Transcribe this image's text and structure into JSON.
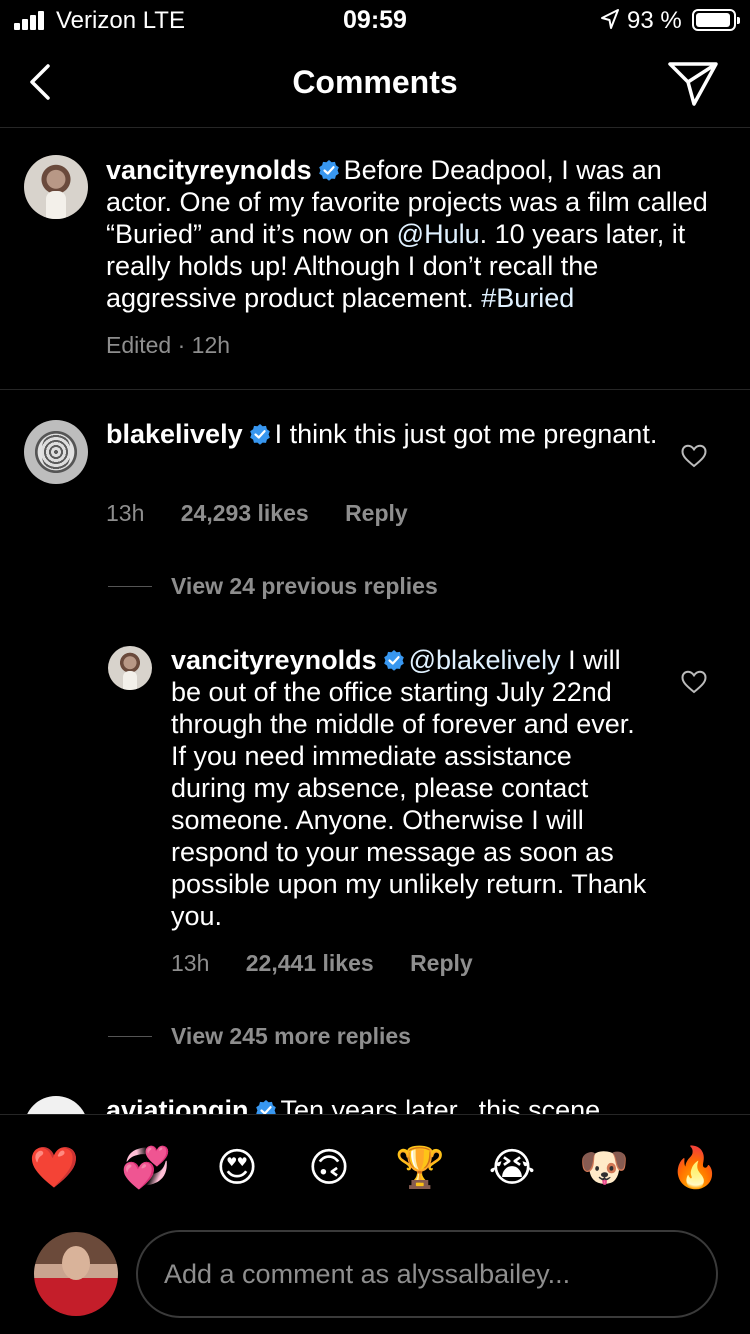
{
  "status_bar": {
    "carrier": "Verizon  LTE",
    "time": "09:59",
    "battery_percent": "93 %",
    "battery_level": 0.93
  },
  "header": {
    "title": "Comments"
  },
  "caption": {
    "username": "vancityreynolds",
    "text_1": "Before Deadpool, I was an actor. One of my favorite projects was a film called “Buried” and it’s now on ",
    "mention": "@Hulu",
    "text_2": ". 10 years later, it really holds up! Although I don’t recall the aggressive product placement. ",
    "hashtag": "#Buried",
    "edited": "Edited",
    "time": "12h"
  },
  "comments": [
    {
      "username": "blakelively",
      "text": "I think this just got me pregnant.",
      "time": "13h",
      "likes": "24,293 likes",
      "reply_label": "Reply",
      "view_replies": "View 24 previous replies",
      "reply": {
        "username": "vancityreynolds",
        "mention": "@blakelively",
        "text": "I will be out of the office starting July 22nd through the middle of forever and ever. If you need immediate assistance during my absence, please contact someone. Anyone. Otherwise I will respond to your message as soon as possible upon my unlikely return. Thank you.",
        "time": "13h",
        "likes": "22,441 likes",
        "reply_label": "Reply"
      },
      "view_more_replies": "View 245 more replies"
    },
    {
      "username": "aviationgin",
      "text": "Ten years later...this scene"
    }
  ],
  "emoji_bar": [
    "❤️",
    "💞",
    "😍",
    "🙃",
    "🏆",
    "😭",
    "🐶",
    "🔥"
  ],
  "comment_input": {
    "placeholder": "Add a comment as alyssalbailey..."
  },
  "colors": {
    "background": "#000000",
    "secondary_text": "#8e8e8e",
    "verified": "#3897f0",
    "divider": "#262626"
  }
}
